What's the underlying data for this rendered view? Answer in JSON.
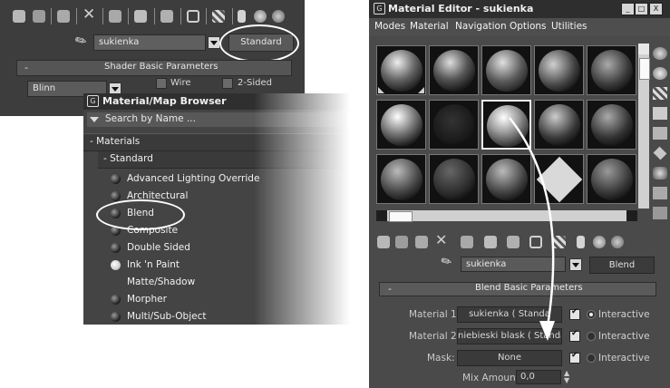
{
  "left_toolbar": {
    "icons": [
      "get-material-icon",
      "put-to-scene-icon",
      "assign-to-selection-icon",
      "reset-icon",
      "make-unique-icon",
      "put-to-library-icon",
      "material-id-channel-icon",
      "show-in-viewport-icon",
      "show-background-icon",
      "show-end-result-icon",
      "go-to-parent-icon",
      "go-forward-icon"
    ]
  },
  "left_material": {
    "name": "sukienka",
    "type_button": "Standard"
  },
  "shader_rollout": {
    "title": "Shader Basic Parameters",
    "shader": "Blinn",
    "wire_label": "Wire",
    "two_sided_label": "2-Sided"
  },
  "browser": {
    "title": "Material/Map Browser",
    "search_placeholder": "Search by Name ...",
    "group_materials": "- Materials",
    "group_standard": "- Standard",
    "items": [
      {
        "label": "Advanced Lighting Override",
        "icon": "dark"
      },
      {
        "label": "Architectural",
        "icon": "dark"
      },
      {
        "label": "Blend",
        "icon": "dark"
      },
      {
        "label": "Composite",
        "icon": "dark"
      },
      {
        "label": "Double Sided",
        "icon": "dark"
      },
      {
        "label": "Ink 'n Paint",
        "icon": "white"
      },
      {
        "label": "Matte/Shadow",
        "icon": "none"
      },
      {
        "label": "Morpher",
        "icon": "dark"
      },
      {
        "label": "Multi/Sub-Object",
        "icon": "dark"
      }
    ]
  },
  "editor": {
    "title": "Material Editor - sukienka",
    "menu": [
      "Modes",
      "Material",
      "Navigation",
      "Options",
      "Utilities"
    ],
    "window_buttons": [
      "_",
      "□",
      "X"
    ],
    "material_name": "sukienka",
    "type_button": "Blend"
  },
  "blend_rollout": {
    "title": "Blend Basic Parameters",
    "material1_label": "Material 1:",
    "material1_value": "sukienka  ( Standa",
    "material2_label": "Material 2:",
    "material2_value": "niebieski blask  ( Standard )",
    "mask_label": "Mask:",
    "mask_value": "None",
    "interactive_label": "Interactive",
    "mix_amount_label": "Mix Amount:",
    "mix_amount_value": "0,0"
  },
  "colors": {
    "panel_dark": "#3d3d3d",
    "panel_mid": "#4a4a4a",
    "title_bar": "#2e2e2e",
    "highlight_circle": "#ffffff"
  }
}
